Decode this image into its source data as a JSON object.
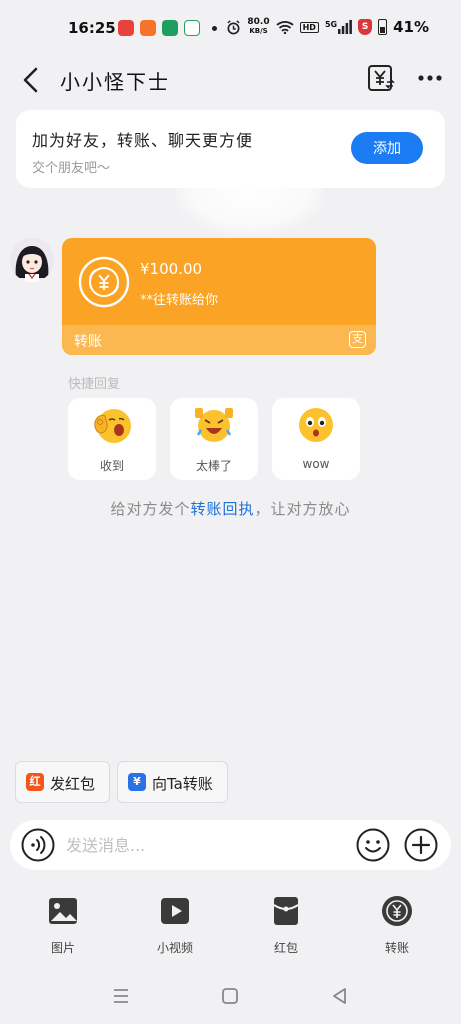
{
  "status_bar": {
    "time": "16:25",
    "net_speed_value": "80.0",
    "net_speed_unit": "KB/S",
    "hd_label": "HD",
    "signal_label": "5G",
    "battery": "41%"
  },
  "header": {
    "title": "小小怪下士"
  },
  "add_friend": {
    "title": "加为好友，转账、聊天更方便",
    "subtitle": "交个朋友吧～",
    "button": "添加"
  },
  "transfer": {
    "amount": "¥100.00",
    "note": "**往转账给你",
    "type_label": "转账",
    "badge": "支"
  },
  "quick_reply": {
    "title": "快捷回复",
    "items": [
      {
        "label": "收到",
        "icon": "ok-hand-emoji-icon"
      },
      {
        "label": "太棒了",
        "icon": "thumbs-up-laughing-emoji-icon"
      },
      {
        "label": "wow",
        "icon": "surprised-emoji-icon"
      }
    ]
  },
  "receipt_hint": {
    "prefix": "给对方发个",
    "link": "转账回执",
    "suffix": "，让对方放心"
  },
  "chips": {
    "red_packet": "发红包",
    "transfer_to": "向Ta转账",
    "red_packet_icon": "红",
    "transfer_icon": "¥"
  },
  "input": {
    "placeholder": "发送消息..."
  },
  "tools": [
    {
      "label": "图片",
      "icon": "image-icon"
    },
    {
      "label": "小视频",
      "icon": "video-icon"
    },
    {
      "label": "红包",
      "icon": "red-packet-icon"
    },
    {
      "label": "转账",
      "icon": "transfer-coin-icon"
    }
  ],
  "colors": {
    "accent": "#1b7cf3",
    "transfer": "#fba324",
    "link": "#1b6fd8"
  }
}
